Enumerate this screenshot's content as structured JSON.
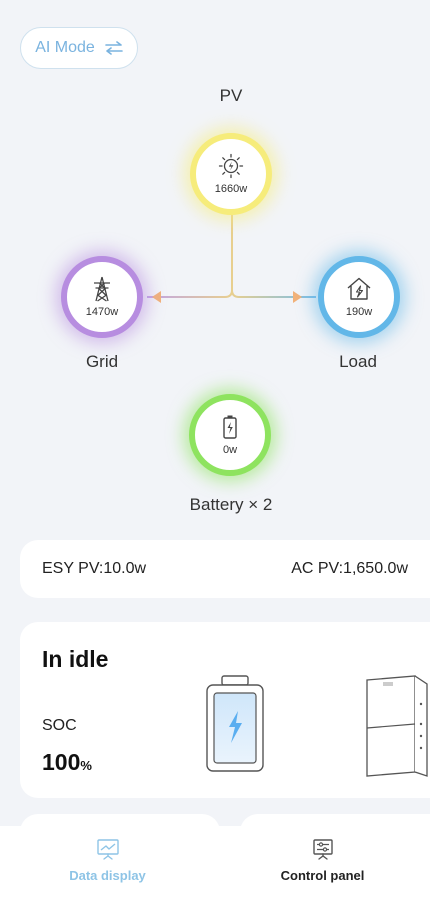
{
  "mode_button": {
    "label": "AI Mode",
    "icon": "swap-icon"
  },
  "flow": {
    "pv": {
      "label": "PV",
      "value": "1660w",
      "icon": "solar-panel-icon",
      "color": "#f6ec7b"
    },
    "grid": {
      "label": "Grid",
      "value": "1470w",
      "icon": "power-tower-icon",
      "color": "#b78de0"
    },
    "load": {
      "label": "Load",
      "value": "190w",
      "icon": "house-icon",
      "color": "#62b7e8"
    },
    "battery": {
      "label": "Battery × 2",
      "value": "0w",
      "icon": "battery-charging-icon",
      "color": "#8ee35f"
    },
    "arrow_color": "#f2b27a"
  },
  "pv_summary": {
    "esy_pv": "ESY PV:10.0w",
    "ac_pv": "AC PV:1,650.0w"
  },
  "status": {
    "title": "In idle",
    "soc_label": "SOC",
    "soc_value": "100",
    "soc_unit": "%"
  },
  "tabs": [
    {
      "label": "Data display",
      "icon": "presentation-chart-icon",
      "active": true
    },
    {
      "label": "Control panel",
      "icon": "sliders-panel-icon",
      "active": false
    }
  ]
}
